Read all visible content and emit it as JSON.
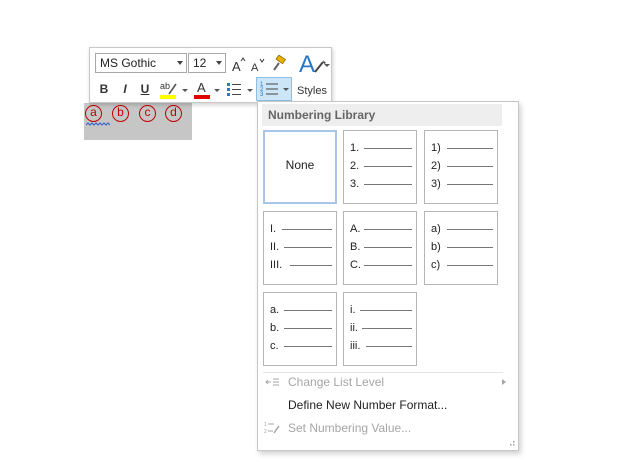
{
  "document": {
    "selected_text": [
      "ⓐ",
      "ⓑ",
      "ⓒ",
      "ⓓ"
    ]
  },
  "mini_toolbar": {
    "font_name": "MS Gothic",
    "font_size": "12",
    "bold_label": "B",
    "italic_label": "I",
    "underline_label": "U",
    "font_color_label": "A",
    "styles_label": "Styles",
    "colors": {
      "highlight": "#ffff00",
      "font_color": "#e00000",
      "accent": "#2b78c4"
    }
  },
  "numbering_panel": {
    "header": "Numbering Library",
    "tiles": [
      {
        "type": "none",
        "label": "None",
        "selected": true
      },
      {
        "type": "list",
        "items": [
          "1.",
          "2.",
          "3."
        ]
      },
      {
        "type": "list",
        "items": [
          "1)",
          "2)",
          "3)"
        ]
      },
      {
        "type": "list",
        "items": [
          "I.",
          "II.",
          "III."
        ]
      },
      {
        "type": "list",
        "items": [
          "A.",
          "B.",
          "C."
        ]
      },
      {
        "type": "list",
        "items": [
          "a)",
          "b)",
          "c)"
        ]
      },
      {
        "type": "list",
        "items": [
          "a.",
          "b.",
          "c."
        ]
      },
      {
        "type": "list",
        "items": [
          "i.",
          "ii.",
          "iii."
        ]
      }
    ],
    "menu": [
      {
        "label": "Change List Level",
        "disabled": true,
        "icon": "change-level-icon",
        "submenu": true
      },
      {
        "label": "Define New Number Format...",
        "disabled": false,
        "icon": "",
        "submenu": false
      },
      {
        "label": "Set Numbering Value...",
        "disabled": true,
        "icon": "set-value-icon",
        "submenu": false
      }
    ]
  }
}
